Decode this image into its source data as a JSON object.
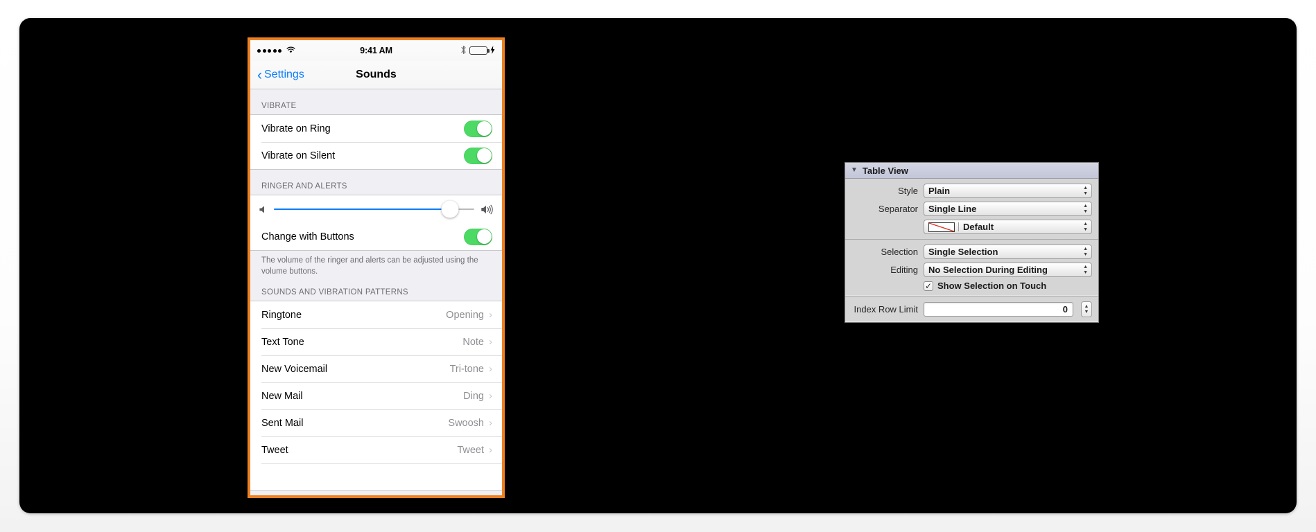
{
  "phone": {
    "status_bar": {
      "signal_dots": 5,
      "wifi_icon": "wifi-icon",
      "time": "9:41 AM",
      "bluetooth_icon": "bluetooth-icon",
      "battery_icon": "battery-icon",
      "charging_icon": "charging-bolt-icon",
      "battery_color": "#4CD964"
    },
    "nav": {
      "back_label": "Settings",
      "back_chevron": "‹",
      "title": "Sounds",
      "tint_color": "#0a7cff"
    },
    "sections": {
      "vibrate": {
        "header": "VIBRATE",
        "rows": [
          {
            "label": "Vibrate on Ring",
            "control": "toggle",
            "on": true
          },
          {
            "label": "Vibrate on Silent",
            "control": "toggle",
            "on": true
          }
        ]
      },
      "ringer": {
        "header": "RINGER AND ALERTS",
        "slider": {
          "value_percent": 88,
          "min_icon": "speaker-low-icon",
          "max_icon": "speaker-high-icon",
          "fill_color": "#0a7cff"
        },
        "change_with_buttons": {
          "label": "Change with Buttons",
          "control": "toggle",
          "on": true
        },
        "footnote": "The volume of the ringer and alerts can be adjusted using the volume buttons."
      },
      "sounds": {
        "header": "SOUNDS AND VIBRATION PATTERNS",
        "rows": [
          {
            "label": "Ringtone",
            "value": "Opening"
          },
          {
            "label": "Text Tone",
            "value": "Note"
          },
          {
            "label": "New Voicemail",
            "value": "Tri-tone"
          },
          {
            "label": "New Mail",
            "value": "Ding"
          },
          {
            "label": "Sent Mail",
            "value": "Swoosh"
          },
          {
            "label": "Tweet",
            "value": "Tweet"
          }
        ],
        "disclosure_icon": "chevron-right-icon"
      }
    },
    "highlight_color": "#ED8121"
  },
  "inspector": {
    "header": {
      "title": "Table View",
      "disclosure_icon": "triangle-down-icon"
    },
    "group1": {
      "rows": [
        {
          "label": "Style",
          "value": "Plain",
          "control": "popup"
        },
        {
          "label": "Separator",
          "value": "Single Line",
          "control": "popup"
        },
        {
          "label": "",
          "value": "Default",
          "control": "color-popup",
          "swatch": "no-color-swatch"
        }
      ]
    },
    "group2": {
      "rows": [
        {
          "label": "Selection",
          "value": "Single Selection",
          "control": "popup"
        },
        {
          "label": "Editing",
          "value": "No Selection During Editing",
          "control": "popup"
        }
      ],
      "checkbox": {
        "label": "Show Selection on Touch",
        "checked": true,
        "mark": "✓"
      }
    },
    "group3": {
      "label": "Index Row Limit",
      "value": "0",
      "stepper_up": "▲",
      "stepper_down": "▼"
    },
    "popup_arrow_up": "▲",
    "popup_arrow_down": "▼"
  }
}
